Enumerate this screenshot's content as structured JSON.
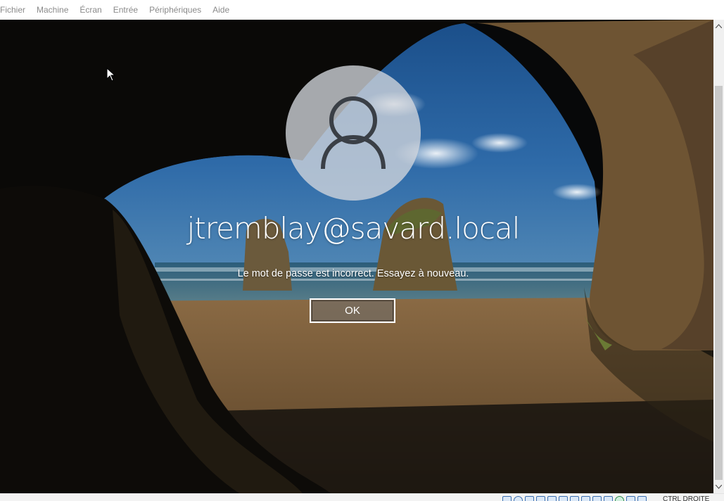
{
  "menubar": {
    "items": [
      {
        "label": "Fichier"
      },
      {
        "label": "Machine"
      },
      {
        "label": "Écran"
      },
      {
        "label": "Entrée"
      },
      {
        "label": "Périphériques"
      },
      {
        "label": "Aide"
      }
    ]
  },
  "login": {
    "username": "jtremblay@savard.local",
    "error_message": "Le mot de passe est incorrect. Essayez à nouveau.",
    "ok_label": "OK",
    "avatar_icon": "user-silhouette-icon"
  },
  "statusbar": {
    "host_key_label": "CTRL DROITE",
    "icons": [
      "hard-disk-icon",
      "optical-drive-icon",
      "floppy-icon",
      "audio-icon",
      "network-icon",
      "usb-icon",
      "shared-folder-icon",
      "display-icon",
      "video-capture-icon",
      "recording-icon",
      "mouse-integration-icon",
      "cpu-icon",
      "arrow-down-icon"
    ]
  },
  "colors": {
    "screen_bg_dark": "#0b0e10",
    "sky": "#2a5d92",
    "sand": "#7a5a36",
    "rock": "#4a3a22",
    "error_text": "#ffffff",
    "menu_text": "#8a8a8a"
  }
}
